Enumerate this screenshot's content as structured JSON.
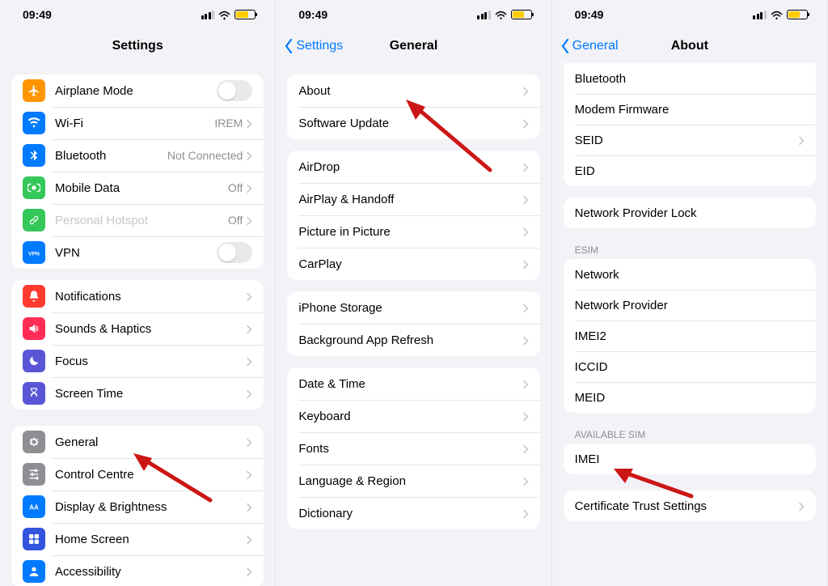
{
  "status": {
    "time": "09:49"
  },
  "screen1": {
    "title": "Settings",
    "g1": [
      {
        "id": "airplane",
        "label": "Airplane Mode",
        "icon": "airplane",
        "color": "#ff9500",
        "trailing": "toggle"
      },
      {
        "id": "wifi",
        "label": "Wi-Fi",
        "icon": "wifi",
        "color": "#007aff",
        "value": "IREM",
        "trailing": "chev"
      },
      {
        "id": "bluetooth",
        "label": "Bluetooth",
        "icon": "bluetooth",
        "color": "#007aff",
        "value": "Not Connected",
        "trailing": "chev"
      },
      {
        "id": "mobile",
        "label": "Mobile Data",
        "icon": "antenna",
        "color": "#34c759",
        "value": "Off",
        "trailing": "chev"
      },
      {
        "id": "hotspot",
        "label": "Personal Hotspot",
        "icon": "link",
        "color": "#34c759",
        "dim": true,
        "value": "Off",
        "trailing": "chev"
      },
      {
        "id": "vpn",
        "label": "VPN",
        "icon": "vpn",
        "color": "#007aff",
        "trailing": "toggle"
      }
    ],
    "g2": [
      {
        "id": "notifications",
        "label": "Notifications",
        "icon": "bell",
        "color": "#ff3b30"
      },
      {
        "id": "sounds",
        "label": "Sounds & Haptics",
        "icon": "speaker",
        "color": "#ff2d55"
      },
      {
        "id": "focus",
        "label": "Focus",
        "icon": "moon",
        "color": "#5856d6"
      },
      {
        "id": "screentime",
        "label": "Screen Time",
        "icon": "hourglass",
        "color": "#5856d6"
      }
    ],
    "g3": [
      {
        "id": "general",
        "label": "General",
        "icon": "gear",
        "color": "#8e8e93"
      },
      {
        "id": "control",
        "label": "Control Centre",
        "icon": "sliders",
        "color": "#8e8e93"
      },
      {
        "id": "display",
        "label": "Display & Brightness",
        "icon": "aa",
        "color": "#007aff"
      },
      {
        "id": "home",
        "label": "Home Screen",
        "icon": "grid",
        "color": "#3355dd"
      },
      {
        "id": "accessibility",
        "label": "Accessibility",
        "icon": "person",
        "color": "#007aff"
      }
    ]
  },
  "screen2": {
    "back": "Settings",
    "title": "General",
    "g1": [
      {
        "id": "about",
        "label": "About"
      },
      {
        "id": "software",
        "label": "Software Update"
      }
    ],
    "g2": [
      {
        "id": "airdrop",
        "label": "AirDrop"
      },
      {
        "id": "airplay",
        "label": "AirPlay & Handoff"
      },
      {
        "id": "pip",
        "label": "Picture in Picture"
      },
      {
        "id": "carplay",
        "label": "CarPlay"
      }
    ],
    "g3": [
      {
        "id": "storage",
        "label": "iPhone Storage"
      },
      {
        "id": "refresh",
        "label": "Background App Refresh"
      }
    ],
    "g4": [
      {
        "id": "datetime",
        "label": "Date & Time"
      },
      {
        "id": "keyboard",
        "label": "Keyboard"
      },
      {
        "id": "fonts",
        "label": "Fonts"
      },
      {
        "id": "lang",
        "label": "Language & Region"
      },
      {
        "id": "dict",
        "label": "Dictionary"
      }
    ]
  },
  "screen3": {
    "back": "General",
    "title": "About",
    "g1": [
      {
        "id": "bt",
        "label": "Bluetooth"
      },
      {
        "id": "modem",
        "label": "Modem Firmware"
      },
      {
        "id": "seid",
        "label": "SEID",
        "chev": true
      },
      {
        "id": "eid",
        "label": "EID"
      }
    ],
    "g1b": [
      {
        "id": "nplock",
        "label": "Network Provider Lock"
      }
    ],
    "h1": "ESIM",
    "g2": [
      {
        "id": "network",
        "label": "Network"
      },
      {
        "id": "nprovider",
        "label": "Network Provider"
      },
      {
        "id": "imei2",
        "label": "IMEI2"
      },
      {
        "id": "iccid",
        "label": "ICCID"
      },
      {
        "id": "meid",
        "label": "MEID"
      }
    ],
    "h2": "AVAILABLE SIM",
    "g3": [
      {
        "id": "imei",
        "label": "IMEI"
      }
    ],
    "g4": [
      {
        "id": "cert",
        "label": "Certificate Trust Settings",
        "chev": true
      }
    ]
  }
}
